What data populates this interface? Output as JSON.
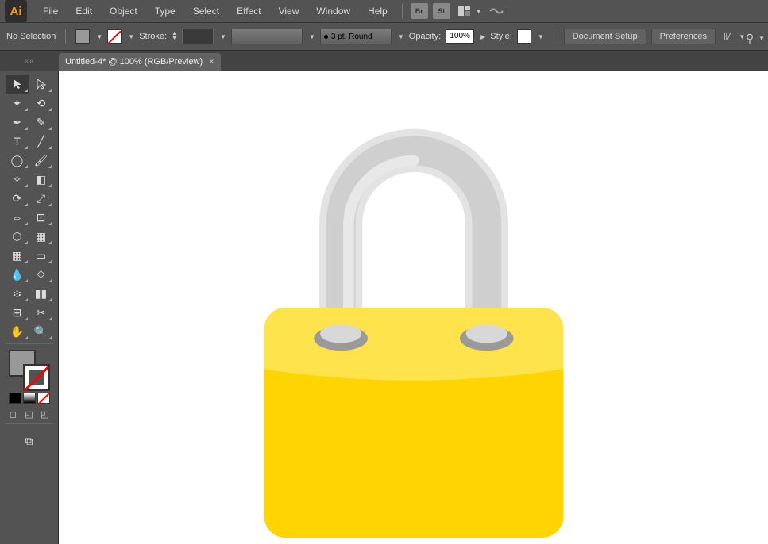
{
  "menu": {
    "items": [
      "File",
      "Edit",
      "Object",
      "Type",
      "Select",
      "Effect",
      "View",
      "Window",
      "Help"
    ],
    "bridge": "Br",
    "stock": "St"
  },
  "control": {
    "selection_status": "No Selection",
    "stroke_label": "Stroke:",
    "brush_size": "3 pt. Round",
    "opacity_label": "Opacity:",
    "opacity_value": "100%",
    "style_label": "Style:",
    "doc_setup": "Document Setup",
    "prefs": "Preferences"
  },
  "tab": {
    "title": "Untitled-4* @ 100% (RGB/Preview)",
    "close": "×"
  },
  "tools": {
    "grip": "««"
  },
  "artwork": {
    "description": "yellow padlock with grey shackle",
    "body_color": "#ffd400",
    "body_highlight": "#ffe34d",
    "shackle_light": "#e3e3e3",
    "shackle_mid": "#cfcfcf",
    "shackle_dark": "#bfbfbf",
    "hole_color": "#9a9a9a"
  }
}
